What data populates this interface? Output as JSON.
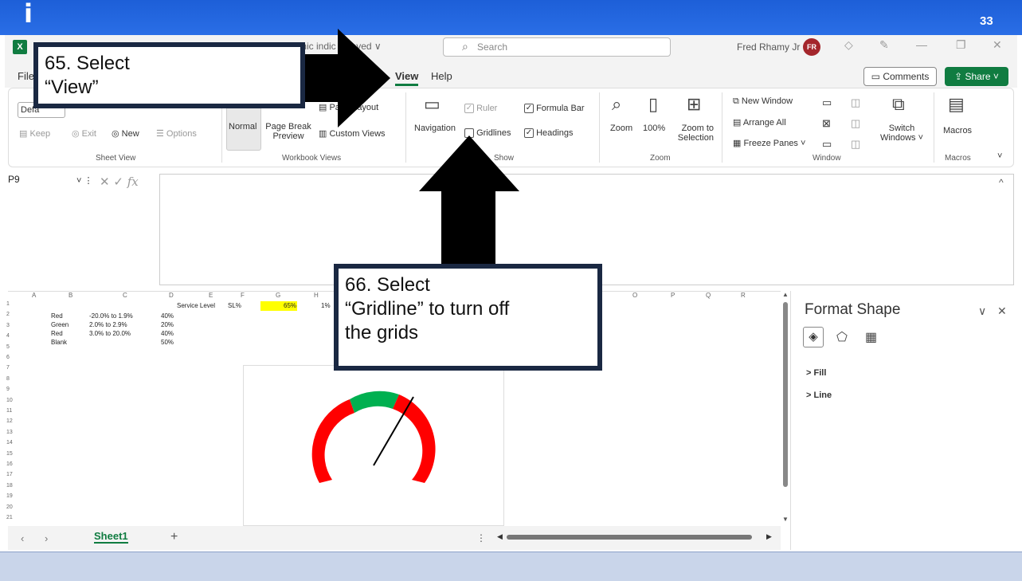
{
  "slide": {
    "number": "33",
    "logo": "i"
  },
  "titlebar": {
    "app_icon": "X",
    "doc_title": "mic indic",
    "saved": "• Saved ∨",
    "search_placeholder": "Search",
    "user_name": "Fred Rhamy Jr",
    "avatar_initials": "FR"
  },
  "tabs": {
    "file": "File",
    "view": "View",
    "help": "Help",
    "comments": "Comments",
    "share": "Share"
  },
  "ribbon": {
    "sheet_view": {
      "default": "Defa",
      "keep": "Keep",
      "exit": "Exit",
      "new": "New",
      "options": "Options",
      "group": "Sheet View"
    },
    "workbook_views": {
      "normal": "Normal",
      "page_break": "Page Break",
      "preview": "Preview",
      "page_layout": "Page Layout",
      "custom_views": "Custom Views",
      "group": "Workbook Views"
    },
    "show": {
      "navigation": "Navigation",
      "ruler": "Ruler",
      "formula_bar": "Formula Bar",
      "gridlines": "Gridlines",
      "headings": "Headings",
      "group": "Show"
    },
    "zoom": {
      "zoom": "Zoom",
      "hundred": "100%",
      "zoom_to": "Zoom to",
      "selection": "Selection",
      "group": "Zoom"
    },
    "window": {
      "new_window": "New Window",
      "arrange_all": "Arrange All",
      "freeze_panes": "Freeze Panes",
      "switch": "Switch",
      "windows": "Windows",
      "group": "Window"
    },
    "macros": {
      "label": "Macros",
      "group": "Macros"
    }
  },
  "formula": {
    "namebox": "P9",
    "fx": "fx"
  },
  "grid": {
    "columns": [
      "A",
      "B",
      "C",
      "D",
      "E",
      "F",
      "G",
      "H",
      "O",
      "P",
      "Q",
      "R"
    ],
    "rows": [
      "1",
      "2",
      "3",
      "4",
      "5",
      "6",
      "7",
      "8",
      "9",
      "10",
      "11",
      "12",
      "13",
      "14",
      "15",
      "16",
      "17",
      "18",
      "19",
      "20",
      "21"
    ],
    "r1_e": "Service Level",
    "r1_f": "SL%",
    "r1_g": "65%",
    "r1_h": "1%",
    "r2": [
      "Red",
      "-20.0% to 1.9%",
      "40%"
    ],
    "r3": [
      "Green",
      "2.0% to 2.9%",
      "20%"
    ],
    "r4": [
      "Red",
      "3.0% to 20.0%",
      "40%"
    ],
    "r5": [
      "Blank",
      "",
      "50%"
    ]
  },
  "gauge": {
    "colors": {
      "red": "#ff0000",
      "green": "#00b050"
    }
  },
  "sheets": {
    "active": "Sheet1",
    "add": "+"
  },
  "pane": {
    "title": "Format Shape",
    "fill": "Fill",
    "line": "Line"
  },
  "callouts": {
    "c1_line1": "65. Select",
    "c1_line2": "“View”",
    "c2_line1": "66. Select",
    "c2_line2": "“Gridline” to turn off",
    "c2_line3": "the grids"
  }
}
